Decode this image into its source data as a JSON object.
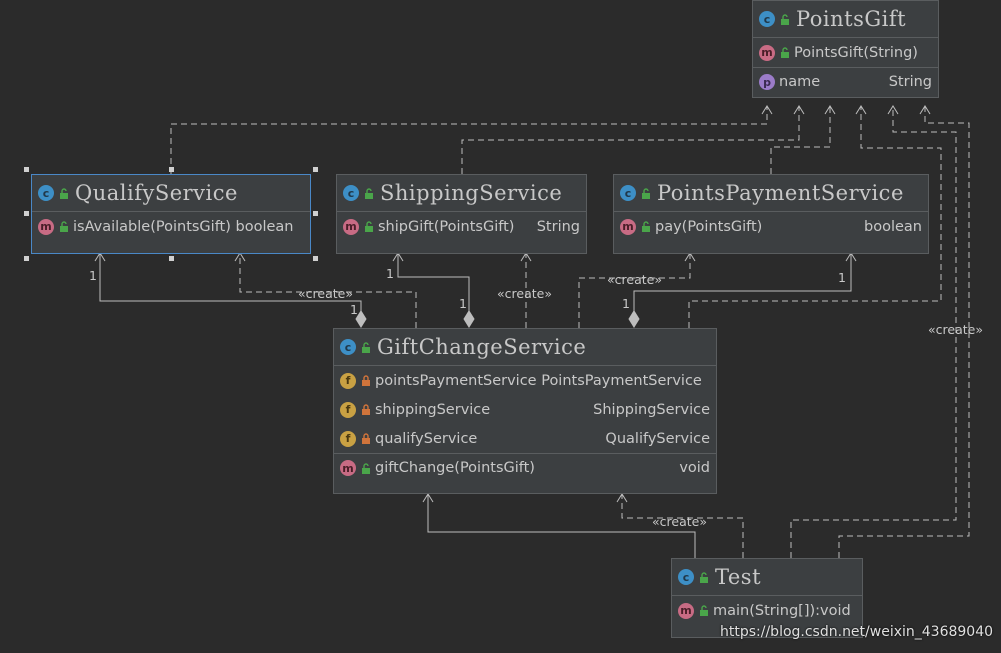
{
  "classes": {
    "points_gift": {
      "title": "PointsGift",
      "constructor": "PointsGift(String)",
      "field_name": "name",
      "field_type": "String"
    },
    "qualify_service": {
      "title": "QualifyService",
      "method": "isAvailable(PointsGift) boolean"
    },
    "shipping_service": {
      "title": "ShippingService",
      "method": "shipGift(PointsGift)",
      "method_type": "String"
    },
    "points_payment_service": {
      "title": "PointsPaymentService",
      "method": "pay(PointsGift)",
      "method_type": "boolean"
    },
    "gift_change_service": {
      "title": "GiftChangeService",
      "fields": [
        {
          "name": "pointsPaymentService PointsPaymentService",
          "type": ""
        },
        {
          "name": "shippingService",
          "type": "ShippingService"
        },
        {
          "name": "qualifyService",
          "type": "QualifyService"
        }
      ],
      "method": "giftChange(PointsGift)",
      "method_type": "void"
    },
    "test": {
      "title": "Test",
      "method": "main(String[]):void"
    }
  },
  "icons": {
    "class": "class-icon",
    "method": "method-icon",
    "field": "field-icon",
    "property": "property-icon",
    "public": "public-visibility-icon",
    "private": "private-lock-icon"
  },
  "edge_labels": {
    "create": "«create»",
    "one": "1"
  },
  "watermark": "https://blog.csdn.net/weixin_43689040",
  "colors": {
    "background": "#2b2b2b",
    "box": "#3c3f41",
    "selected_border": "#4a88c7",
    "class_icon": "#3d8fc6",
    "method_icon": "#c86b84",
    "field_icon": "#c9a143",
    "property_icon": "#9b7cc9"
  }
}
